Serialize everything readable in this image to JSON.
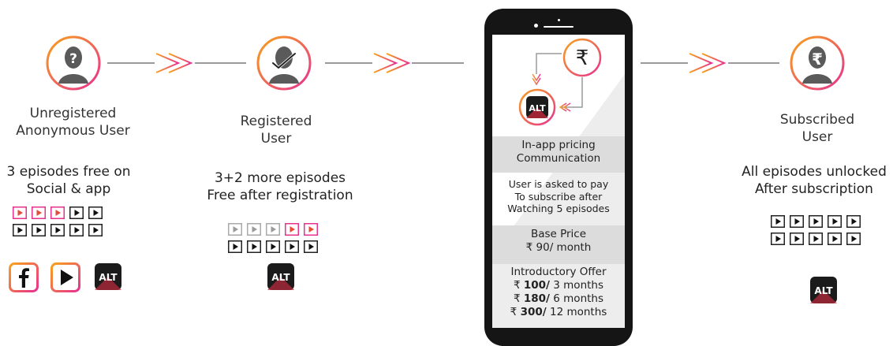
{
  "stages": [
    {
      "id": "unregistered",
      "label": [
        "Unregistered",
        "Anonymous User"
      ],
      "desc": [
        "3 episodes free on",
        "Social & app"
      ],
      "episode_rows": [
        [
          "free",
          "free",
          "free",
          "locked",
          "locked"
        ],
        [
          "locked",
          "locked",
          "locked",
          "locked",
          "locked"
        ]
      ],
      "avatar_icon": "question-user-icon",
      "platform_icons": [
        "facebook-icon",
        "youtube-play-icon",
        "altbalaji-app-icon"
      ]
    },
    {
      "id": "registered",
      "label": [
        "Registered",
        "User"
      ],
      "desc": [
        "3+2 more episodes",
        "Free after registration"
      ],
      "episode_rows": [
        [
          "watched",
          "watched",
          "watched",
          "free",
          "free"
        ],
        [
          "locked",
          "locked",
          "locked",
          "locked",
          "locked"
        ]
      ],
      "avatar_icon": "registered-user-icon",
      "platform_icons": [
        "altbalaji-app-icon"
      ]
    },
    {
      "id": "subscribed",
      "label": [
        "Subscribed",
        "User"
      ],
      "desc": [
        "All episodes unlocked",
        "After subscription"
      ],
      "episode_rows": [
        [
          "locked",
          "locked",
          "locked",
          "locked",
          "locked"
        ],
        [
          "locked",
          "locked",
          "locked",
          "locked",
          "locked"
        ]
      ],
      "avatar_icon": "rupee-user-icon",
      "platform_icons": [
        "altbalaji-app-icon"
      ]
    }
  ],
  "phone": {
    "rupee_symbol": "₹",
    "app_logo_text": "ALT",
    "pricing_title": [
      "In-app pricing",
      "Communication"
    ],
    "ask_text": [
      "User is asked to pay",
      "To subscribe after",
      "Watching 5 episodes"
    ],
    "base_price_title": "Base Price",
    "base_price_value": "₹ 90/ month",
    "offer_title": "Introductory Offer",
    "offers": [
      {
        "prefix": "₹ ",
        "amount": "100/",
        "period": " 3 months"
      },
      {
        "prefix": "₹ ",
        "amount": "180/",
        "period": " 6 months"
      },
      {
        "prefix": "₹ ",
        "amount": "300/",
        "period": " 12 months"
      }
    ]
  },
  "colors": {
    "gradient_start": "#f7a21b",
    "gradient_end": "#e8318f",
    "arrow_grey": "#9a9a9a",
    "phone_body": "#151515",
    "panel_grey": "#dcdcdc"
  }
}
